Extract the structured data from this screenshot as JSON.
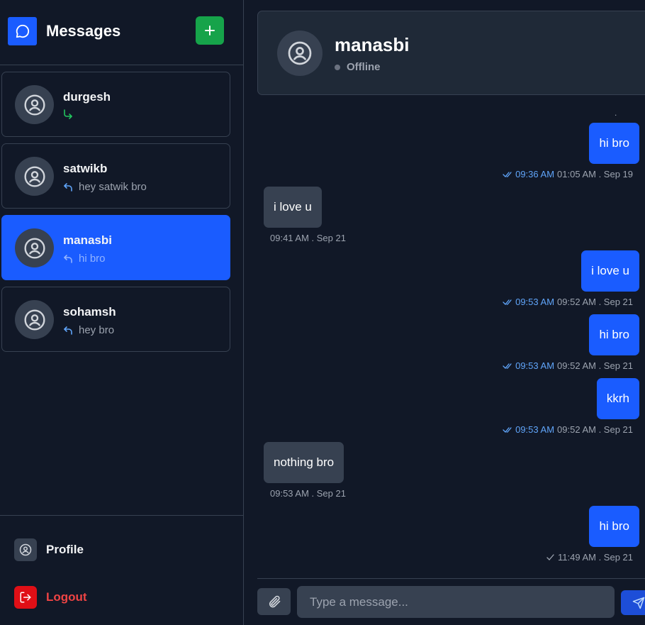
{
  "sidebar": {
    "title": "Messages",
    "contacts": [
      {
        "name": "durgesh",
        "preview": ""
      },
      {
        "name": "satwikb",
        "preview": "hey satwik bro"
      },
      {
        "name": "manasbi",
        "preview": "hi bro"
      },
      {
        "name": "sohamsh",
        "preview": "hey bro"
      }
    ],
    "footer": {
      "profile_label": "Profile",
      "logout_label": "Logout"
    }
  },
  "chat": {
    "name": "manasbi",
    "status": "Offline",
    "top_marker": ".",
    "messages": [
      {
        "direction": "out",
        "text": "hi bro",
        "read_time": "09:36 AM",
        "time": "01:05 AM . Sep 19"
      },
      {
        "direction": "in",
        "text": "i love u",
        "time": "09:41 AM . Sep 21"
      },
      {
        "direction": "out",
        "text": "i love u",
        "read_time": "09:53 AM",
        "time": "09:52 AM . Sep 21"
      },
      {
        "direction": "out",
        "text": "hi bro",
        "read_time": "09:53 AM",
        "time": "09:52 AM . Sep 21"
      },
      {
        "direction": "out",
        "text": "kkrh",
        "read_time": "09:53 AM",
        "time": "09:52 AM . Sep 21"
      },
      {
        "direction": "in",
        "text": "nothing bro",
        "time": "09:53 AM . Sep 21"
      },
      {
        "direction": "out",
        "text": "hi bro",
        "read_time": "",
        "time": "11:49 AM . Sep 21"
      }
    ],
    "input": {
      "placeholder": "Type a message..."
    }
  },
  "colors": {
    "accent": "#1a5cff",
    "new_chat": "#16a34a",
    "logout": "#ef4444",
    "read_receipt": "#60a5fa"
  },
  "icons": {
    "logo": "chat-bubble-icon",
    "new_chat": "plus-icon",
    "avatar": "user-circle-icon",
    "reply": "reply-arrow-icon",
    "forward": "forward-arrow-icon",
    "profile": "user-circle-icon",
    "logout": "logout-icon",
    "attach": "paperclip-icon",
    "send": "send-icon",
    "read": "double-check-icon",
    "sent": "check-icon"
  }
}
